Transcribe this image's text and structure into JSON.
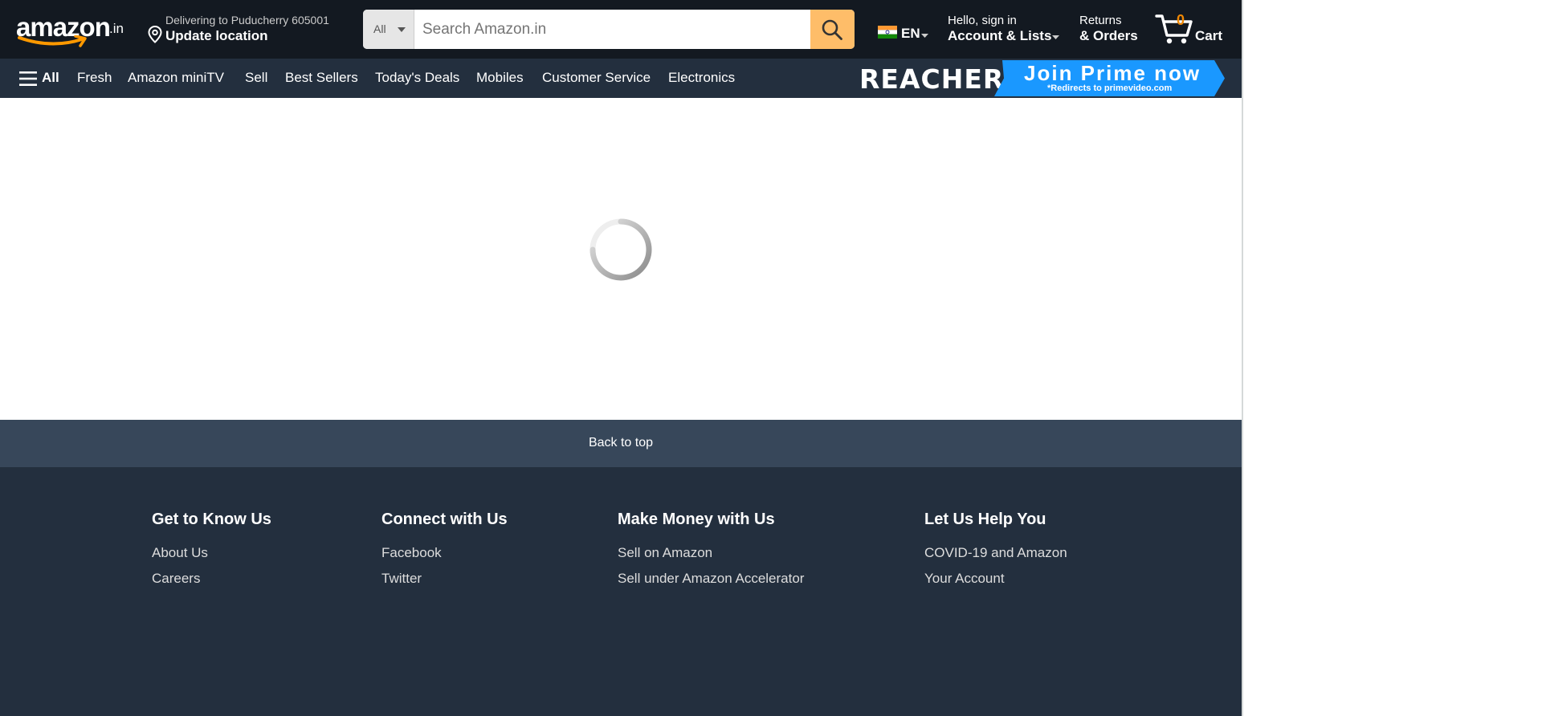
{
  "header": {
    "logo_text": "amazon",
    "logo_tld": ".in",
    "location_line1": "Delivering to Puducherry 605001",
    "location_line2": "Update location",
    "search": {
      "category": "All",
      "placeholder": "Search Amazon.in"
    },
    "language": "EN",
    "account_line1": "Hello, sign in",
    "account_line2": "Account & Lists",
    "orders_line1": "Returns",
    "orders_line2": "& Orders",
    "cart_count": "0",
    "cart_label": "Cart"
  },
  "subnav": {
    "all_label": "All",
    "links": [
      "Fresh",
      "Amazon miniTV",
      "Sell",
      "Best Sellers",
      "Today's Deals",
      "Mobiles",
      "Customer Service",
      "Electronics"
    ],
    "banner": {
      "title": "REACHER",
      "cta": "Join Prime now",
      "subtext": "*Redirects to primevideo.com"
    }
  },
  "back_to_top": "Back to top",
  "footer": {
    "columns": [
      {
        "heading": "Get to Know Us",
        "items": [
          "About Us",
          "Careers"
        ]
      },
      {
        "heading": "Connect with Us",
        "items": [
          "Facebook",
          "Twitter"
        ]
      },
      {
        "heading": "Make Money with Us",
        "items": [
          "Sell on Amazon",
          "Sell under Amazon Accelerator"
        ]
      },
      {
        "heading": "Let Us Help You",
        "items": [
          "COVID-19 and Amazon",
          "Your Account"
        ]
      }
    ]
  },
  "colors": {
    "nav_top": "#131921",
    "nav_sub": "#232f3e",
    "search_button": "#febd69",
    "cart_count": "#f08804",
    "back_to_top": "#37475a",
    "footer": "#232f3e",
    "prime_banner": "#1a98ff"
  }
}
